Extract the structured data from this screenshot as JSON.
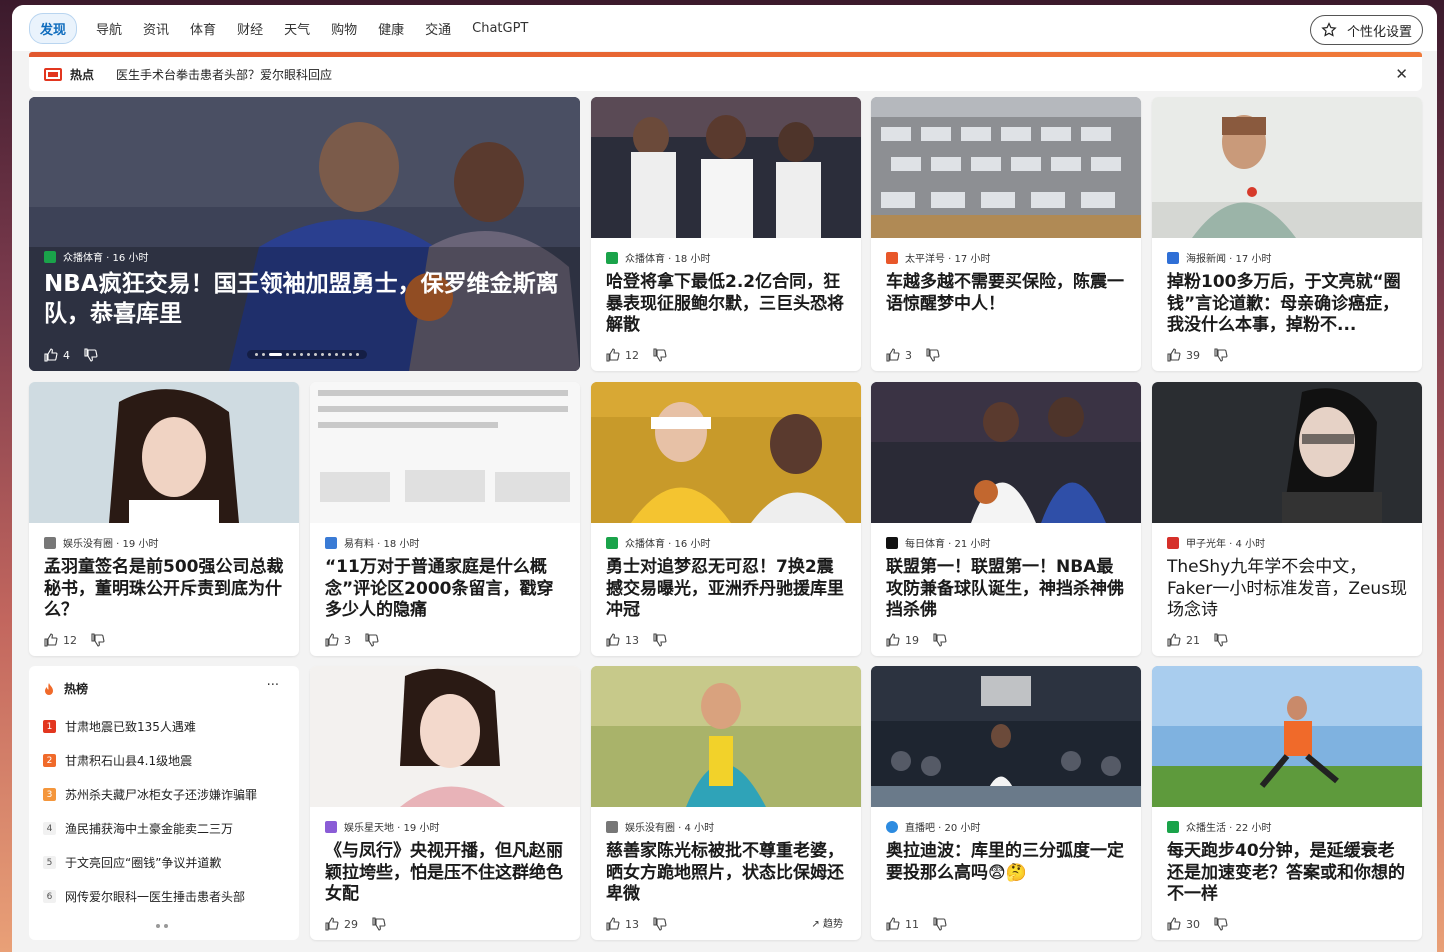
{
  "nav": {
    "tabs": [
      "发现",
      "导航",
      "资讯",
      "体育",
      "财经",
      "天气",
      "购物",
      "健康",
      "交通",
      "ChatGPT"
    ],
    "personalize_label": "个性化设置"
  },
  "hot": {
    "label": "热点",
    "text": "医生手术台拳击患者头部？爱尔眼科回应"
  },
  "hero": {
    "source": "众播体育 · 16 小时",
    "title": "NBA疯狂交易！国王领袖加盟勇士，保罗维金斯离队，恭喜库里",
    "likes": "4"
  },
  "cards": [
    {
      "source": "众播体育 · 18 小时",
      "title": "哈登将拿下最低2.2亿合同，狂暴表现征服鲍尔默，三巨头恐将解散",
      "likes": "12",
      "logo": "#1aa34a"
    },
    {
      "source": "太平洋号 · 17 小时",
      "title": "车越多越不需要买保险，陈震一语惊醒梦中人！",
      "likes": "3",
      "logo": "#e8572a"
    },
    {
      "source": "海报新闻 · 17 小时",
      "title": "掉粉100多万后，于文亮就“圈钱”言论道歉：母亲确诊癌症，我没什么本事，掉粉不...",
      "likes": "39",
      "logo": "#2f6fd6"
    },
    {
      "source": "娱乐没有圈 · 19 小时",
      "title": "孟羽童签名是前500强公司总裁秘书，董明珠公开斥责到底为什么？",
      "likes": "12",
      "logo": "#555"
    },
    {
      "source": "易有料 · 18 小时",
      "title": "“11万对于普通家庭是什么概念”评论区2000条留言，戳穿多少人的隐痛",
      "likes": "3",
      "logo": "#3a7bd5"
    },
    {
      "source": "众播体育 · 16 小时",
      "title": "勇士对追梦忍无可忍！7换2震撼交易曝光，亚洲乔丹驰援库里冲冠",
      "likes": "13",
      "logo": "#1aa34a"
    },
    {
      "source": "每日体育 · 21 小时",
      "title": "联盟第一！联盟第一！NBA最攻防兼备球队诞生，神挡杀神佛挡杀佛",
      "likes": "19",
      "logo": "#111"
    },
    {
      "source": "甲子光年 · 4 小时",
      "title": "TheShy九年学不会中文，Faker一小时标准发音，Zeus现场念诗",
      "likes": "21",
      "logo": "#d6302a"
    },
    {
      "source": "娱乐星天地 · 19 小时",
      "title": "《与凤行》央视开播，但凡赵丽颖拉垮些，怕是压不住这群绝色女配",
      "likes": "29",
      "logo": "#8a5cd6"
    },
    {
      "source": "娱乐没有圈 · 4 小时",
      "title": "慈善家陈光标被批不尊重老婆，晒女方跪地照片，状态比保姆还卑微",
      "likes": "13",
      "logo": "#555",
      "trend": "趋势"
    },
    {
      "source": "直播吧 · 20 小时",
      "title": "奥拉迪波：库里的三分弧度一定要投那么高吗😨🤔",
      "likes": "11",
      "logo": "#2d8be0"
    },
    {
      "source": "众播生活 · 22 小时",
      "title": "每天跑步40分钟，是延缓衰老还是加速变老？答案或和你想的不一样",
      "likes": "30",
      "logo": "#1aa34a"
    }
  ],
  "trending": {
    "title": "热榜",
    "more": "···",
    "items": [
      "甘肃地震已致135人遇难",
      "甘肃积石山县4.1级地震",
      "苏州杀夫藏尸冰柜女子还涉嫌诈骗罪",
      "渔民捕获海中土豪金能卖二三万",
      "于文亮回应“圈钱”争议并道歉",
      "网传爱尔眼科一医生捶击患者头部"
    ]
  }
}
